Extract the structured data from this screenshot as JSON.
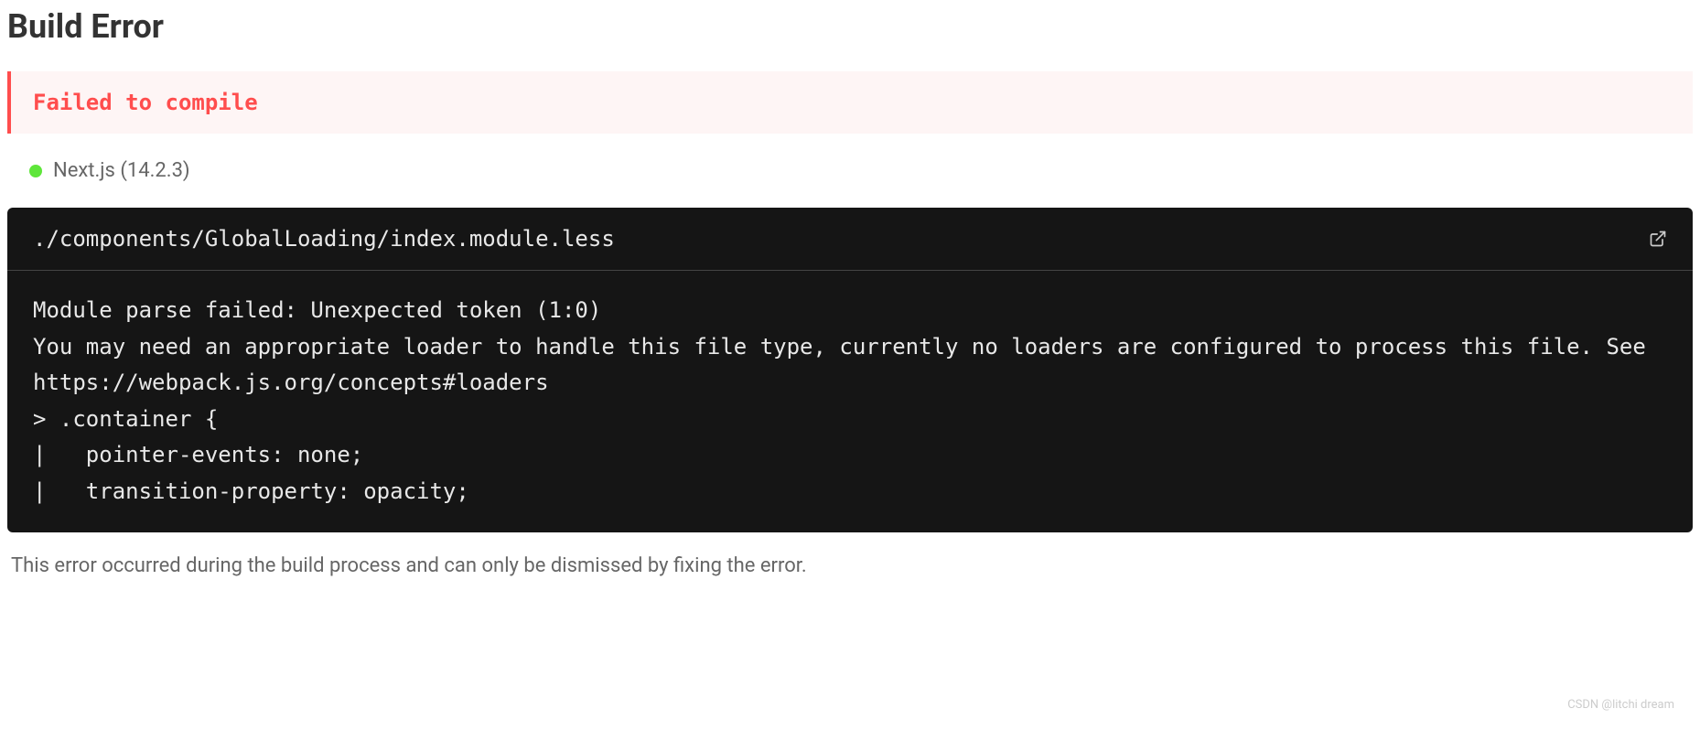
{
  "title": "Build Error",
  "error_banner": "Failed to compile",
  "framework": {
    "label": "Next.js (14.2.3)"
  },
  "code": {
    "path": "./components/GlobalLoading/index.module.less",
    "body": "Module parse failed: Unexpected token (1:0)\nYou may need an appropriate loader to handle this file type, currently no loaders are configured to process this file. See https://webpack.js.org/concepts#loaders\n> .container {\n|   pointer-events: none;\n|   transition-property: opacity;"
  },
  "footer": "This error occurred during the build process and can only be dismissed by fixing the error.",
  "watermark": "CSDN @litchi dream"
}
